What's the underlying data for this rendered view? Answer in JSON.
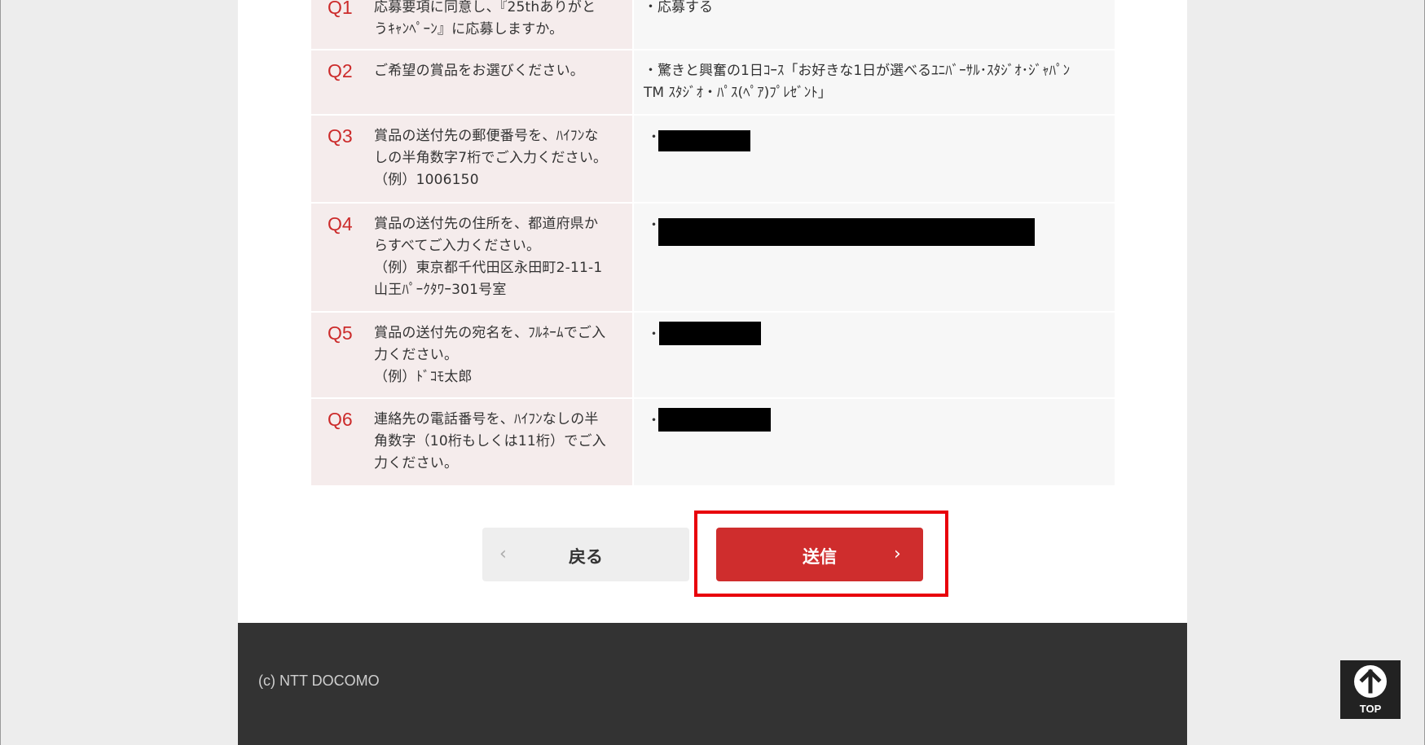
{
  "questions": [
    {
      "num": "Q1",
      "text": "応募要項に同意し、『25thありがと\nうｷｬﾝﾍﾟｰﾝ』に応募しますか。",
      "answer": "・応募する"
    },
    {
      "num": "Q2",
      "text": "ご希望の賞品をお選びください。",
      "answer": "・驚きと興奮の1日ｺｰｽ「お好きな1日が選べるﾕﾆﾊﾞｰｻﾙ･ｽﾀｼﾞｵ･ｼﾞｬﾊﾟﾝ\nTM ｽﾀｼﾞｵ・ﾊﾟｽ(ﾍﾟｱ)ﾌﾟﾚｾﾞﾝﾄ」"
    },
    {
      "num": "Q3",
      "text": "賞品の送付先の郵便番号を、ﾊｲﾌﾝな\nしの半角数字7桁でご入力ください。\n（例）1006150",
      "answer": "・"
    },
    {
      "num": "Q4",
      "text": "賞品の送付先の住所を、都道府県か\nらすべてご入力ください。\n（例）東京都千代田区永田町2-11-1\n山王ﾊﾟｰｸﾀﾜｰ301号室",
      "answer": "・"
    },
    {
      "num": "Q5",
      "text": "賞品の送付先の宛名を、ﾌﾙﾈｰﾑでご入\n力ください。\n（例）ﾄﾞｺﾓ太郎",
      "answer": "・"
    },
    {
      "num": "Q6",
      "text": "連絡先の電話番号を、ﾊｲﾌﾝなしの半\n角数字（10桁もしくは11桁）でご入\n力ください。",
      "answer": "・"
    }
  ],
  "buttons": {
    "back_label": "戻る",
    "back_chevron": "‹",
    "send_label": "送信",
    "send_chevron": "›"
  },
  "footer": {
    "copyright": "(c) NTT DOCOMO"
  },
  "top_button": {
    "label": "TOP",
    "icon": "arrow-up-icon"
  },
  "colors": {
    "accent_red": "#cf2d2d",
    "question_number": "#cc2b2b",
    "highlight_border": "#e8000b",
    "footer_bg": "#333333"
  }
}
